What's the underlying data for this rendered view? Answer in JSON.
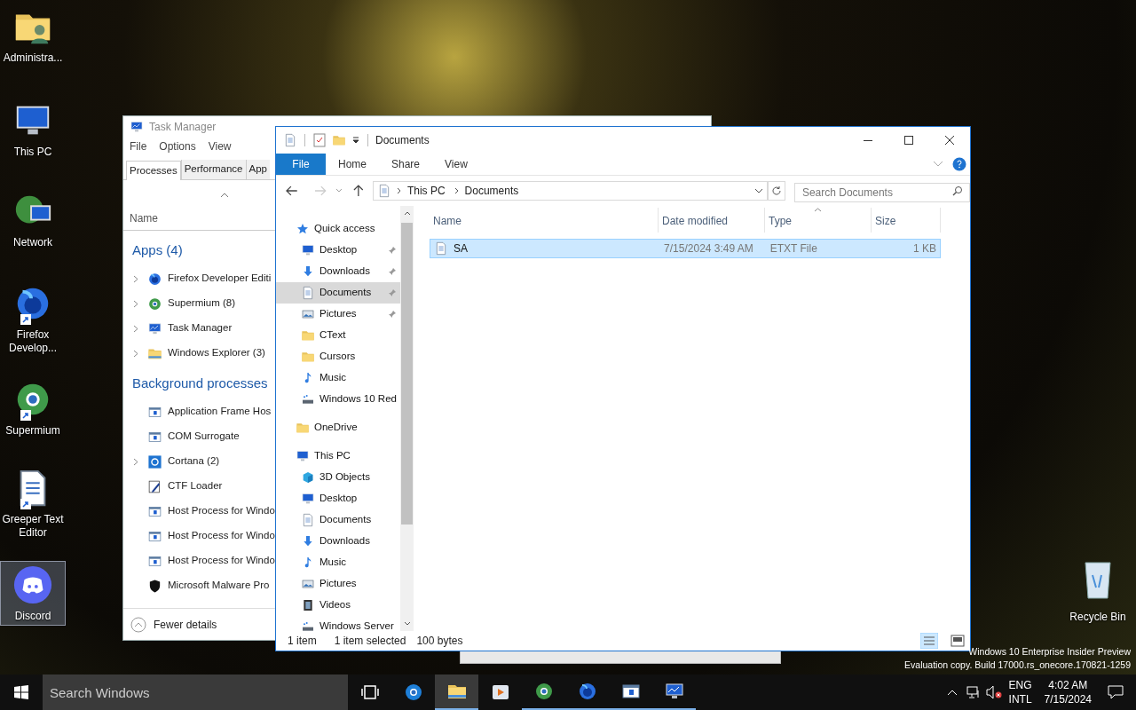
{
  "desktop": {
    "icons": [
      {
        "label": "Administra...",
        "kind": "user-folder",
        "shortcut": false,
        "selected": false
      },
      {
        "label": "This PC",
        "kind": "pc",
        "shortcut": false,
        "selected": false
      },
      {
        "label": "Network",
        "kind": "network",
        "shortcut": false,
        "selected": false
      },
      {
        "label": "Firefox Develop...",
        "kind": "firefox",
        "shortcut": true,
        "selected": false
      },
      {
        "label": "Supermium",
        "kind": "supermium",
        "shortcut": true,
        "selected": false
      },
      {
        "label": "Greeper Text Editor",
        "kind": "textdoc",
        "shortcut": true,
        "selected": false
      },
      {
        "label": "Discord",
        "kind": "discord",
        "shortcut": false,
        "selected": true
      }
    ],
    "recycle_bin": {
      "label": "Recycle Bin"
    },
    "watermark": [
      "Windows 10 Enterprise Insider Preview",
      "Evaluation copy. Build 17000.rs_onecore.170821-1259"
    ]
  },
  "task_manager": {
    "title": "Task Manager",
    "menu": [
      "File",
      "Options",
      "View"
    ],
    "tabs": [
      {
        "label": "Processes",
        "selected": true
      },
      {
        "label": "Performance",
        "selected": false
      },
      {
        "label": "App",
        "selected": false
      }
    ],
    "column": "Name",
    "groups": [
      {
        "title": "Apps (4)",
        "items": [
          {
            "name": "Firefox Developer Editi",
            "kind": "firefox",
            "expandable": true
          },
          {
            "name": "Supermium (8)",
            "kind": "supermium",
            "expandable": true
          },
          {
            "name": "Task Manager",
            "kind": "taskmgr",
            "expandable": true
          },
          {
            "name": "Windows Explorer (3)",
            "kind": "explorer",
            "expandable": true
          }
        ]
      },
      {
        "title": "Background processes",
        "items": [
          {
            "name": "Application Frame Hos",
            "kind": "app",
            "expandable": false
          },
          {
            "name": "COM Surrogate",
            "kind": "app",
            "expandable": false
          },
          {
            "name": "Cortana (2)",
            "kind": "cortana",
            "expandable": true
          },
          {
            "name": "CTF Loader",
            "kind": "pen",
            "expandable": false
          },
          {
            "name": "Host Process for Windo",
            "kind": "app",
            "expandable": false
          },
          {
            "name": "Host Process for Windo",
            "kind": "app",
            "expandable": false
          },
          {
            "name": "Host Process for Windo",
            "kind": "app",
            "expandable": false
          },
          {
            "name": "Microsoft Malware Pro",
            "kind": "shield",
            "expandable": false
          }
        ]
      }
    ],
    "footer": "Fewer details"
  },
  "explorer": {
    "title": "Documents",
    "ribbon_tabs": [
      {
        "label": "File",
        "kind": "file"
      },
      {
        "label": "Home",
        "kind": "tab"
      },
      {
        "label": "Share",
        "kind": "tab"
      },
      {
        "label": "View",
        "kind": "tab"
      }
    ],
    "path": [
      "This PC",
      "Documents"
    ],
    "search": {
      "placeholder": "Search Documents"
    },
    "nav": [
      {
        "label": "Quick access",
        "kind": "star",
        "pinned": false,
        "selected": false,
        "children": [
          {
            "label": "Desktop",
            "kind": "desktop",
            "pinned": true,
            "selected": false
          },
          {
            "label": "Downloads",
            "kind": "download",
            "pinned": true,
            "selected": false
          },
          {
            "label": "Documents",
            "kind": "doc",
            "pinned": true,
            "selected": true
          },
          {
            "label": "Pictures",
            "kind": "pictures",
            "pinned": true,
            "selected": false
          },
          {
            "label": "CText",
            "kind": "folder",
            "pinned": false,
            "selected": false
          },
          {
            "label": "Cursors",
            "kind": "folder",
            "pinned": false,
            "selected": false
          },
          {
            "label": "Music",
            "kind": "music",
            "pinned": false,
            "selected": false
          },
          {
            "label": "Windows 10 Red",
            "kind": "drive",
            "pinned": false,
            "selected": false
          }
        ]
      },
      {
        "label": "OneDrive",
        "kind": "folder",
        "pinned": false,
        "selected": false
      },
      {
        "label": "This PC",
        "kind": "pc",
        "pinned": false,
        "selected": false,
        "children": [
          {
            "label": "3D Objects",
            "kind": "cube",
            "pinned": false,
            "selected": false
          },
          {
            "label": "Desktop",
            "kind": "desktop",
            "pinned": false,
            "selected": false
          },
          {
            "label": "Documents",
            "kind": "doc",
            "pinned": false,
            "selected": false
          },
          {
            "label": "Downloads",
            "kind": "download",
            "pinned": false,
            "selected": false
          },
          {
            "label": "Music",
            "kind": "music",
            "pinned": false,
            "selected": false
          },
          {
            "label": "Pictures",
            "kind": "pictures",
            "pinned": false,
            "selected": false
          },
          {
            "label": "Videos",
            "kind": "video",
            "pinned": false,
            "selected": false
          },
          {
            "label": "Windows Server",
            "kind": "drive",
            "pinned": false,
            "selected": false
          }
        ]
      }
    ],
    "columns": [
      {
        "label": "Name",
        "sorted": false
      },
      {
        "label": "Date modified",
        "sorted": false
      },
      {
        "label": "Type",
        "sorted": true
      },
      {
        "label": "Size",
        "sorted": false
      }
    ],
    "rows": [
      {
        "name": "SA",
        "date": "7/15/2024 3:49 AM",
        "type": "ETXT File",
        "size": "1 KB",
        "selected": true
      }
    ],
    "status": [
      "1 item",
      "1 item selected",
      "100 bytes"
    ]
  },
  "taskbar": {
    "search": {
      "placeholder": "Search Windows"
    },
    "apps": [
      {
        "kind": "taskview",
        "running": false,
        "active": false
      },
      {
        "kind": "ie",
        "running": false,
        "active": false
      },
      {
        "kind": "explorer",
        "running": true,
        "active": true
      },
      {
        "kind": "media",
        "running": false,
        "active": false
      },
      {
        "kind": "supermium",
        "running": true,
        "active": false
      },
      {
        "kind": "firefox",
        "running": true,
        "active": false
      },
      {
        "kind": "app",
        "running": true,
        "active": false
      },
      {
        "kind": "taskmgr",
        "running": true,
        "active": false
      }
    ],
    "language": [
      "ENG",
      "INTL"
    ],
    "time": "4:02 AM",
    "date": "7/15/2024"
  }
}
